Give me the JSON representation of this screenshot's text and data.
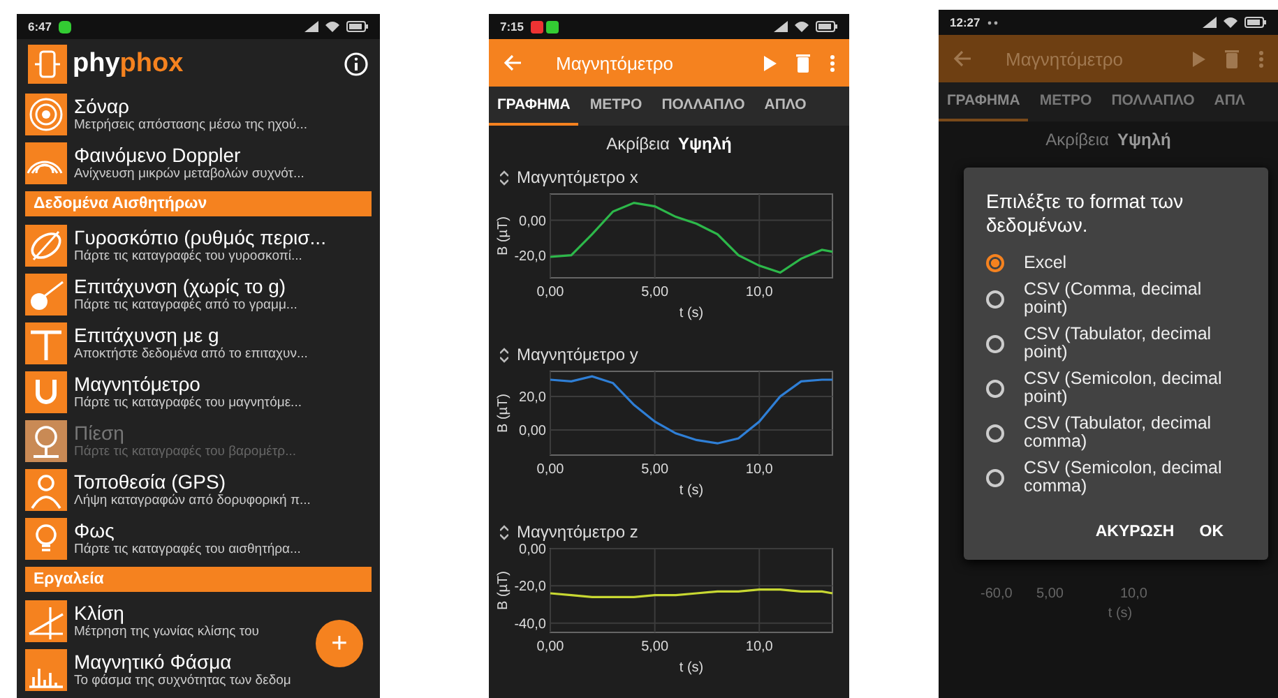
{
  "sensor_list_screen": {
    "status_bar": {
      "time": "6:47"
    },
    "logo": {
      "plain_part": "phy",
      "accent_part": "phox"
    },
    "items": [
      {
        "kind": "experiment",
        "title": "Σόναρ",
        "subtitle": "Μετρήσεις απόστασης μέσω της ηχού...",
        "disabled": false
      },
      {
        "kind": "experiment",
        "title": "Φαινόμενο Doppler",
        "subtitle": "Ανίχνευση μικρών μεταβολών συχνότ...",
        "disabled": false
      },
      {
        "kind": "section",
        "title": "Δεδομένα Αισθητήρων"
      },
      {
        "kind": "experiment",
        "title": "Γυροσκόπιο (ρυθμός περισ...",
        "subtitle": "Πάρτε τις καταγραφές του γυροσκοπί...",
        "disabled": false
      },
      {
        "kind": "experiment",
        "title": "Επιτάχυνση (χωρίς το g)",
        "subtitle": "Πάρτε τις καταγραφές από το γραμμ...",
        "disabled": false
      },
      {
        "kind": "experiment",
        "title": "Επιτάχυνση με g",
        "subtitle": "Αποκτήστε δεδομένα από το επιταχυν...",
        "disabled": false
      },
      {
        "kind": "experiment",
        "title": "Μαγνητόμετρο",
        "subtitle": "Πάρτε τις καταγραφές του μαγνητόμε...",
        "disabled": false
      },
      {
        "kind": "experiment",
        "title": "Πίεση",
        "subtitle": "Πάρτε τις καταγραφές του βαρομέτρ...",
        "disabled": true
      },
      {
        "kind": "experiment",
        "title": "Τοποθεσία (GPS)",
        "subtitle": "Λήψη καταγραφών από δορυφορική π...",
        "disabled": false
      },
      {
        "kind": "experiment",
        "title": "Φως",
        "subtitle": "Πάρτε τις καταγραφές του αισθητήρα...",
        "disabled": false
      },
      {
        "kind": "section",
        "title": "Εργαλεία"
      },
      {
        "kind": "experiment",
        "title": "Κλίση",
        "subtitle": "Μέτρηση της γωνίας κλίσης του",
        "disabled": false
      },
      {
        "kind": "experiment",
        "title": "Μαγνητικό Φάσμα",
        "subtitle": "Το φάσμα της συχνότητας των δεδομ",
        "disabled": false
      }
    ],
    "fab": {
      "label": "+"
    }
  },
  "graph_screen": {
    "status_bar": {
      "time": "7:15"
    },
    "title": "Μαγνητόμετρο",
    "tabs": [
      {
        "label": "ΓΡΑΦΗΜΑ",
        "selected": true
      },
      {
        "label": "ΜΕΤΡΟ",
        "selected": false
      },
      {
        "label": "ΠΟΛΛΑΠΛΟ",
        "selected": false
      },
      {
        "label": "ΑΠΛΟ",
        "selected": false
      }
    ],
    "precision": {
      "label": "Ακρίβεια",
      "value": "Υψηλή"
    },
    "graphs": [
      {
        "chart_data": {
          "type": "line",
          "title": "Μαγνητόμετρο x",
          "xlabel": "t (s)",
          "ylabel": "B (µT)",
          "x": [
            0,
            1,
            2,
            3,
            4,
            5,
            6,
            7,
            8,
            9,
            10,
            11,
            12,
            13,
            13.5
          ],
          "grid": true,
          "series": [
            {
              "color": "#2db84a",
              "values": [
                -21,
                -20,
                -8,
                5,
                10,
                8,
                2,
                -2,
                -8,
                -20,
                -26,
                -30,
                -22,
                -17,
                -18
              ]
            }
          ],
          "xlim": [
            0,
            13.5
          ],
          "ylim": [
            -33,
            15
          ],
          "xticks": [
            {
              "value": 0,
              "label": "0,00"
            },
            {
              "value": 5,
              "label": "5,00"
            },
            {
              "value": 10,
              "label": "10,0"
            }
          ],
          "yticks": [
            {
              "value": 0,
              "label": "0,00"
            },
            {
              "value": -20,
              "label": "-20,0"
            }
          ]
        }
      },
      {
        "chart_data": {
          "type": "line",
          "title": "Μαγνητόμετρο y",
          "xlabel": "t (s)",
          "ylabel": "B (µT)",
          "x": [
            0,
            1,
            2,
            3,
            4,
            5,
            6,
            7,
            8,
            9,
            10,
            11,
            12,
            13,
            13.5
          ],
          "grid": true,
          "series": [
            {
              "color": "#2f7fd6",
              "values": [
                30,
                29,
                32,
                28,
                15,
                5,
                -2,
                -6,
                -8,
                -5,
                5,
                20,
                29,
                30,
                30
              ]
            }
          ],
          "xlim": [
            0,
            13.5
          ],
          "ylim": [
            -15,
            35
          ],
          "xticks": [
            {
              "value": 0,
              "label": "0,00"
            },
            {
              "value": 5,
              "label": "5,00"
            },
            {
              "value": 10,
              "label": "10,0"
            }
          ],
          "yticks": [
            {
              "value": 20,
              "label": "20,0"
            },
            {
              "value": 0,
              "label": "0,00"
            }
          ]
        }
      },
      {
        "chart_data": {
          "type": "line",
          "title": "Μαγνητόμετρο z",
          "xlabel": "t (s)",
          "ylabel": "B (µT)",
          "x": [
            0,
            1,
            2,
            3,
            4,
            5,
            6,
            7,
            8,
            9,
            10,
            11,
            12,
            13,
            13.5
          ],
          "grid": true,
          "series": [
            {
              "color": "#c8d832",
              "values": [
                -24,
                -25,
                -26,
                -26,
                -26,
                -25,
                -25,
                -24,
                -23,
                -23,
                -22,
                -22,
                -23,
                -23,
                -24
              ]
            }
          ],
          "xlim": [
            0,
            13.5
          ],
          "ylim": [
            -45,
            0
          ],
          "xticks": [
            {
              "value": 0,
              "label": "0,00"
            },
            {
              "value": 5,
              "label": "5,00"
            },
            {
              "value": 10,
              "label": "10,0"
            }
          ],
          "yticks": [
            {
              "value": 0,
              "label": "0,00"
            },
            {
              "value": -20,
              "label": "-20,0"
            },
            {
              "value": -40,
              "label": "-40,0"
            }
          ]
        }
      }
    ]
  },
  "export_screen": {
    "status_bar": {
      "time": "12:27"
    },
    "title": "Μαγνητόμετρο",
    "tabs": [
      {
        "label": "ΓΡΑΦΗΜΑ",
        "selected": true
      },
      {
        "label": "ΜΕΤΡΟ",
        "selected": false
      },
      {
        "label": "ΠΟΛΛΑΠΛΟ",
        "selected": false
      },
      {
        "label": "ΑΠΛ",
        "selected": false
      }
    ],
    "precision": {
      "label": "Ακρίβεια",
      "value": "Υψηλή"
    },
    "background_axis": {
      "y_tick": "-60,0",
      "x_ticks": [
        "5,00",
        "10,0"
      ],
      "xlabel": "t (s)"
    },
    "dialog": {
      "title": "Επιλέξτε το format των δεδομένων.",
      "options": [
        {
          "label": "Excel",
          "selected": true
        },
        {
          "label": "CSV (Comma, decimal point)",
          "selected": false
        },
        {
          "label": "CSV (Tabulator, decimal point)",
          "selected": false
        },
        {
          "label": "CSV (Semicolon, decimal point)",
          "selected": false
        },
        {
          "label": "CSV (Tabulator, decimal comma)",
          "selected": false
        },
        {
          "label": "CSV (Semicolon, decimal comma)",
          "selected": false
        }
      ],
      "buttons": [
        "ΑΚΥΡΩΣΗ",
        "OK"
      ]
    }
  }
}
